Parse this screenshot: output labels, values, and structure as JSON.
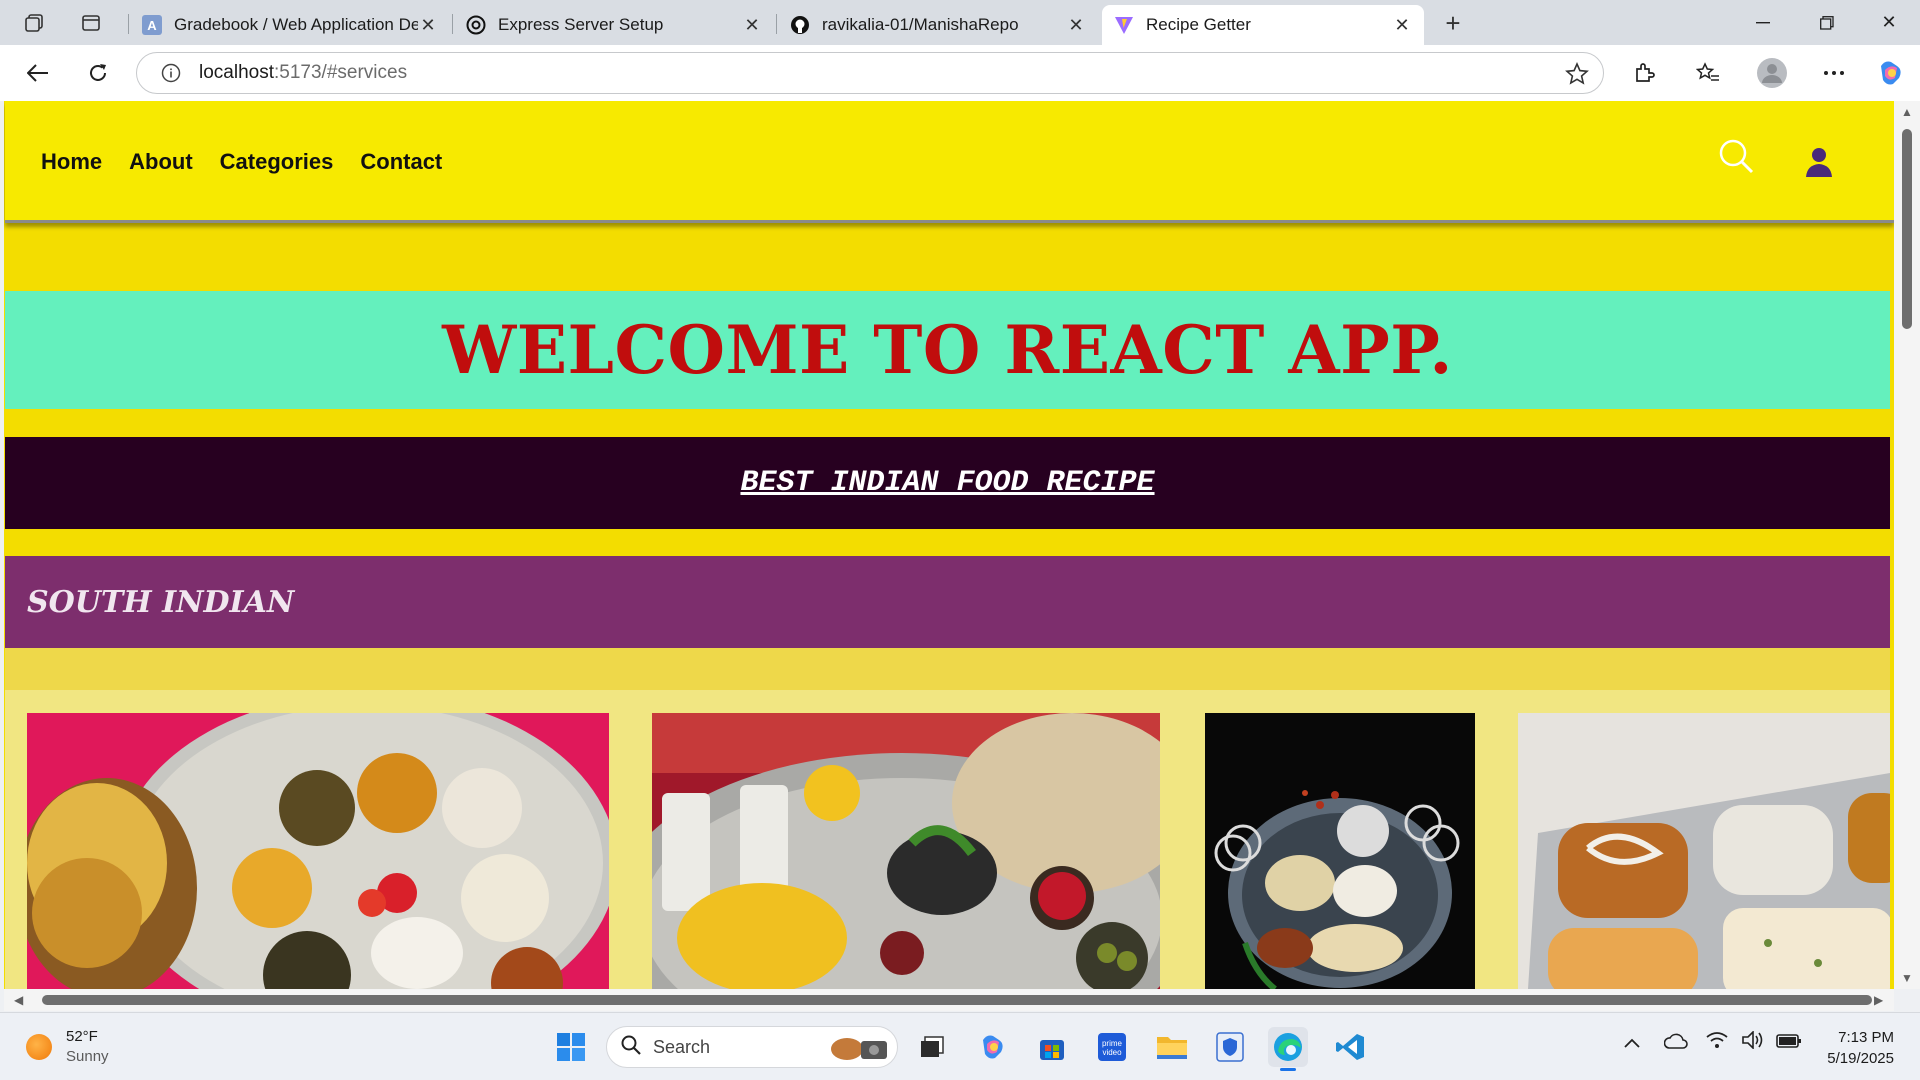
{
  "browser": {
    "tabs": [
      {
        "title": "Gradebook / Web Application De",
        "favicon": "gradebook-icon",
        "active": false
      },
      {
        "title": "Express Server Setup",
        "favicon": "openai-icon",
        "active": false
      },
      {
        "title": "ravikalia-01/ManishaRepo",
        "favicon": "github-icon",
        "active": false
      },
      {
        "title": "Recipe Getter",
        "favicon": "vite-icon",
        "active": true
      }
    ],
    "url_host": "localhost",
    "url_rest": ":5173/#services"
  },
  "site": {
    "nav": [
      "Home",
      "About",
      "Categories",
      "Contact"
    ],
    "welcome": "WELCOME TO REACT APP.",
    "banner": "BEST INDIAN FOOD RECIPE",
    "category": "SOUTH INDIAN"
  },
  "colors": {
    "nav_bg": "#f7ea00",
    "welcome_bg": "#64f0bd",
    "welcome_text": "#c00d0d",
    "banner_bg": "#270020",
    "category_bg": "#7d2e6d"
  },
  "taskbar": {
    "temperature": "52°F",
    "condition": "Sunny",
    "search_placeholder": "Search",
    "time": "7:13 PM",
    "date": "5/19/2025"
  }
}
